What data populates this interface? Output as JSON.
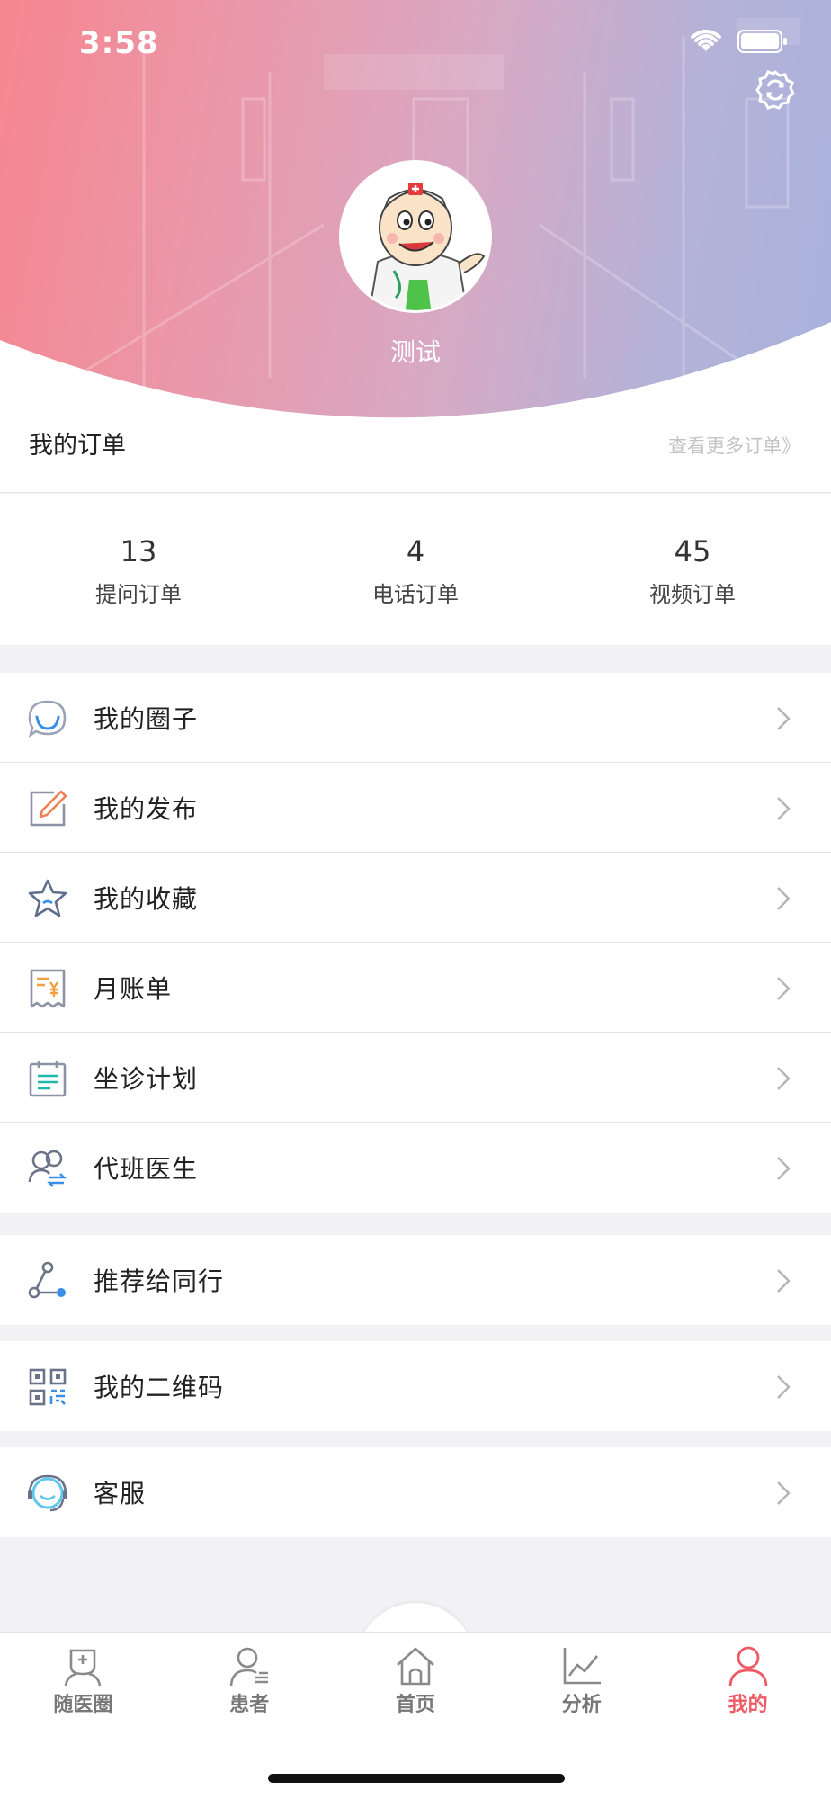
{
  "status_bar": {
    "time": "3:58"
  },
  "profile": {
    "username": "测试"
  },
  "orders": {
    "title": "我的订单",
    "more_link": "查看更多订单》",
    "stats": [
      {
        "count": "13",
        "label": "提问订单"
      },
      {
        "count": "4",
        "label": "电话订单"
      },
      {
        "count": "45",
        "label": "视频订单"
      }
    ]
  },
  "menu": {
    "group1": [
      {
        "label": "我的圈子",
        "icon": "circle-chat-icon"
      },
      {
        "label": "我的发布",
        "icon": "edit-icon"
      },
      {
        "label": "我的收藏",
        "icon": "star-icon"
      },
      {
        "label": "月账单",
        "icon": "bill-icon"
      },
      {
        "label": "坐诊计划",
        "icon": "calendar-icon"
      },
      {
        "label": "代班医生",
        "icon": "doctor-swap-icon"
      }
    ],
    "group2": [
      {
        "label": "推荐给同行",
        "icon": "share-icon"
      }
    ],
    "group3": [
      {
        "label": "我的二维码",
        "icon": "qrcode-icon"
      }
    ],
    "group4": [
      {
        "label": "客服",
        "icon": "headset-icon"
      }
    ]
  },
  "tabbar": {
    "tabs": [
      {
        "label": "随医圈",
        "icon": "doctor-icon"
      },
      {
        "label": "患者",
        "icon": "patient-icon"
      },
      {
        "label": "首页",
        "icon": "home-icon"
      },
      {
        "label": "分析",
        "icon": "chart-icon"
      },
      {
        "label": "我的",
        "icon": "user-icon",
        "active": true
      }
    ]
  },
  "colors": {
    "accent": "#f05a66",
    "background": "#f2f2f4"
  }
}
